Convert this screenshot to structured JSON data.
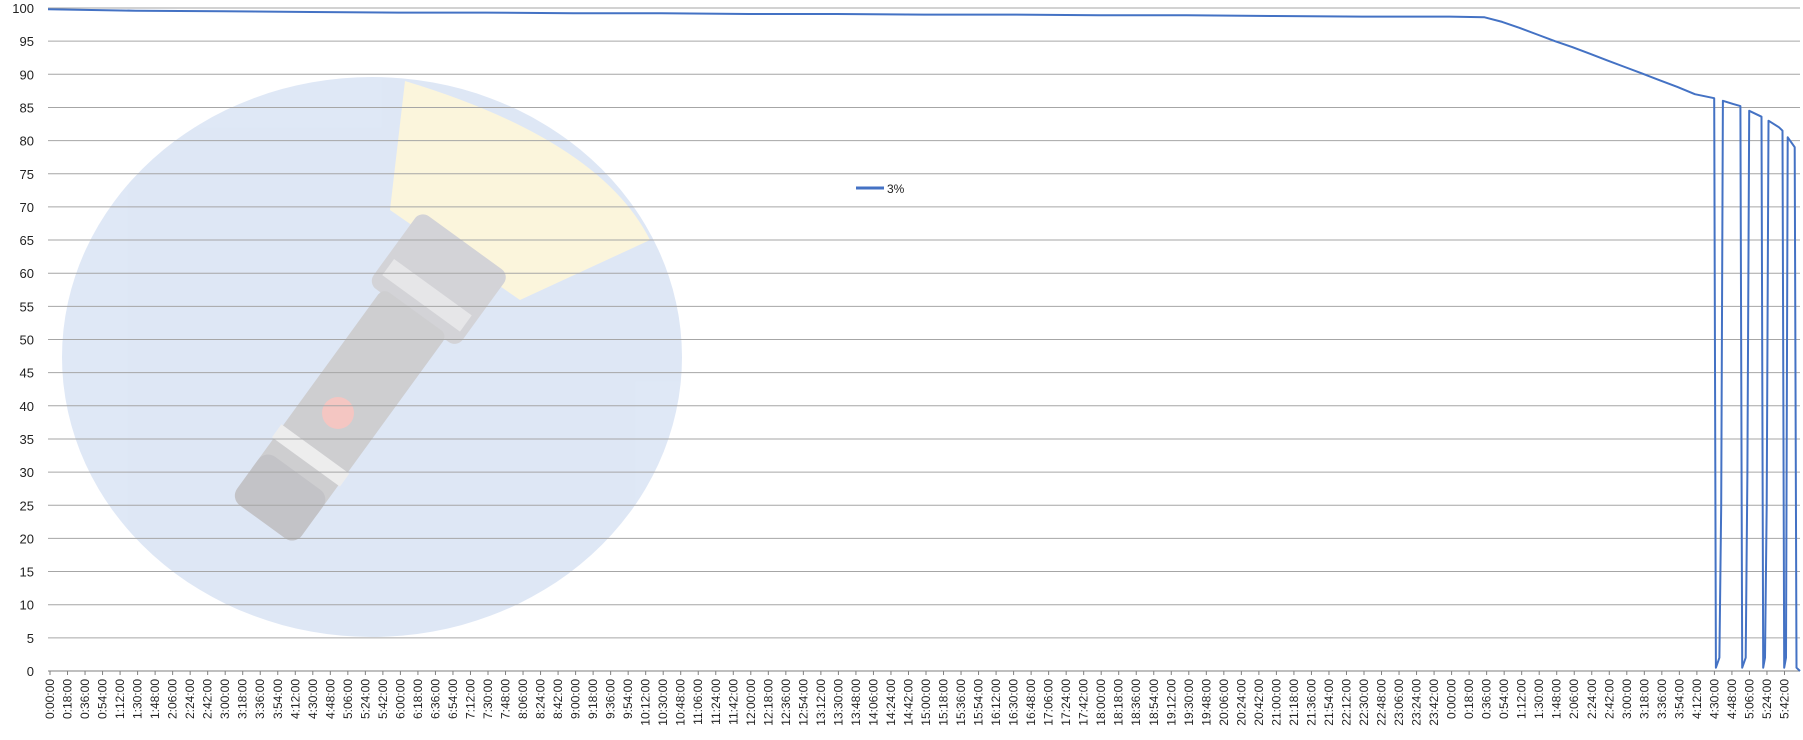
{
  "chart_data": {
    "type": "line",
    "title": "",
    "xlabel": "",
    "ylabel": "",
    "ylim": [
      0,
      100
    ],
    "y_ticks": [
      0,
      5,
      10,
      15,
      20,
      25,
      30,
      35,
      40,
      45,
      50,
      55,
      60,
      65,
      70,
      75,
      80,
      85,
      90,
      95,
      100
    ],
    "grid": "horizontal",
    "legend": "center-top",
    "line_color": "#4472C4",
    "x_tick_labels": [
      "0:00:00",
      "0:18:00",
      "0:36:00",
      "0:54:00",
      "1:12:00",
      "1:30:00",
      "1:48:00",
      "2:06:00",
      "2:24:00",
      "2:42:00",
      "3:00:00",
      "3:18:00",
      "3:36:00",
      "3:54:00",
      "4:12:00",
      "4:30:00",
      "4:48:00",
      "5:06:00",
      "5:24:00",
      "5:42:00",
      "6:00:00",
      "6:18:00",
      "6:36:00",
      "6:54:00",
      "7:12:00",
      "7:30:00",
      "7:48:00",
      "8:06:00",
      "8:24:00",
      "8:42:00",
      "9:00:00",
      "9:18:00",
      "9:36:00",
      "9:54:00",
      "10:12:00",
      "10:30:00",
      "10:48:00",
      "11:06:00",
      "11:24:00",
      "11:42:00",
      "12:00:00",
      "12:18:00",
      "12:36:00",
      "12:54:00",
      "13:12:00",
      "13:30:00",
      "13:48:00",
      "14:06:00",
      "14:24:00",
      "14:42:00",
      "15:00:00",
      "15:18:00",
      "15:36:00",
      "15:54:00",
      "16:12:00",
      "16:30:00",
      "16:48:00",
      "17:06:00",
      "17:24:00",
      "17:42:00",
      "18:00:00",
      "18:18:00",
      "18:36:00",
      "18:54:00",
      "19:12:00",
      "19:30:00",
      "19:48:00",
      "20:06:00",
      "20:24:00",
      "20:42:00",
      "21:00:00",
      "21:18:00",
      "21:36:00",
      "21:54:00",
      "22:12:00",
      "22:30:00",
      "22:48:00",
      "23:06:00",
      "23:24:00",
      "23:42:00",
      "0:00:00",
      "0:18:00",
      "0:36:00",
      "0:54:00",
      "1:12:00",
      "1:30:00",
      "1:48:00",
      "2:06:00",
      "2:24:00",
      "2:42:00",
      "3:00:00",
      "3:18:00",
      "3:36:00",
      "3:54:00",
      "4:12:00",
      "4:30:00",
      "4:48:00",
      "5:06:00",
      "5:24:00",
      "5:42:00"
    ],
    "series": [
      {
        "name": "3%",
        "points": [
          [
            0,
            99.8
          ],
          [
            5,
            99.6
          ],
          [
            10,
            99.5
          ],
          [
            15,
            99.4
          ],
          [
            20,
            99.3
          ],
          [
            25,
            99.3
          ],
          [
            30,
            99.2
          ],
          [
            35,
            99.2
          ],
          [
            40,
            99.1
          ],
          [
            45,
            99.1
          ],
          [
            50,
            99.0
          ],
          [
            55,
            99.0
          ],
          [
            60,
            98.9
          ],
          [
            65,
            98.9
          ],
          [
            70,
            98.8
          ],
          [
            75,
            98.7
          ],
          [
            80,
            98.7
          ],
          [
            82,
            98.6
          ],
          [
            83,
            97.9
          ],
          [
            84,
            97.0
          ],
          [
            85,
            96.0
          ],
          [
            86,
            95.0
          ],
          [
            87,
            94.1
          ],
          [
            88,
            93.1
          ],
          [
            89,
            92.1
          ],
          [
            90,
            91.1
          ],
          [
            91,
            90.1
          ],
          [
            92,
            89.1
          ],
          [
            93,
            88.1
          ],
          [
            94,
            87.0
          ],
          [
            95.1,
            86.4
          ],
          [
            95.2,
            0.5
          ],
          [
            95.4,
            2.0
          ],
          [
            95.5,
            25.0
          ],
          [
            95.6,
            86.0
          ],
          [
            96.2,
            85.5
          ],
          [
            96.6,
            85.2
          ],
          [
            96.7,
            0.5
          ],
          [
            96.9,
            2.0
          ],
          [
            97.0,
            30.0
          ],
          [
            97.1,
            84.5
          ],
          [
            97.8,
            83.6
          ],
          [
            97.9,
            0.5
          ],
          [
            98.0,
            2.0
          ],
          [
            98.1,
            25.0
          ],
          [
            98.2,
            83.0
          ],
          [
            98.8,
            82.0
          ],
          [
            99.0,
            81.5
          ],
          [
            99.1,
            0.5
          ],
          [
            99.2,
            2.0
          ],
          [
            99.3,
            80.5
          ],
          [
            99.7,
            79.0
          ],
          [
            99.8,
            0.5
          ],
          [
            100,
            0.0
          ]
        ]
      }
    ]
  }
}
